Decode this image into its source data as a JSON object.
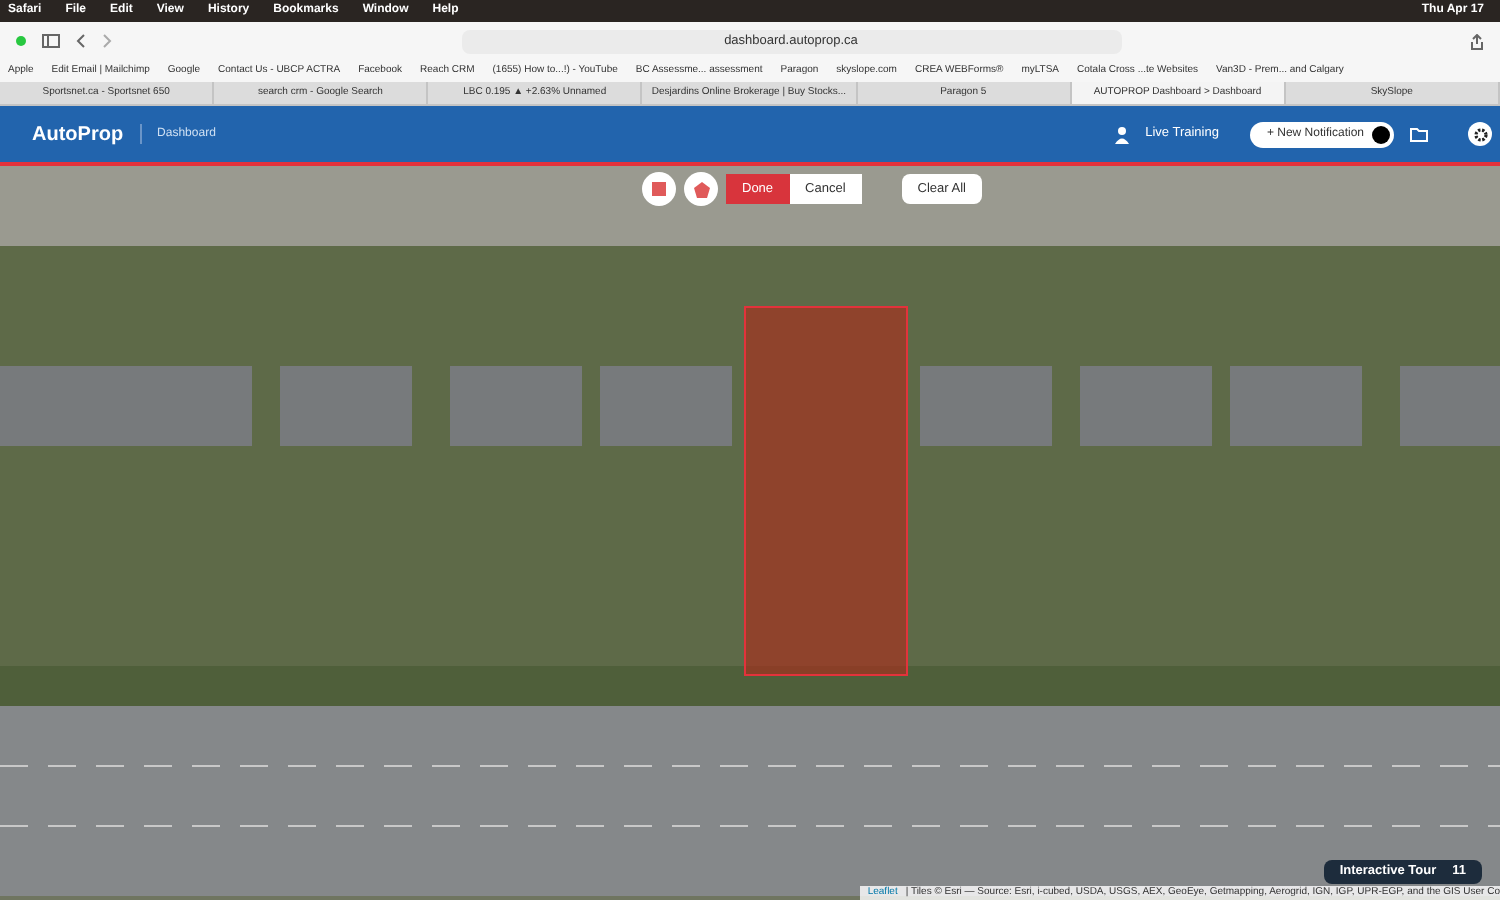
{
  "menu_bar": {
    "items": [
      "Safari",
      "File",
      "Edit",
      "View",
      "History",
      "Bookmarks",
      "Window",
      "Help"
    ],
    "clock": "Thu Apr 17"
  },
  "address_bar": {
    "url": "dashboard.autoprop.ca"
  },
  "bookmarks": [
    "Apple",
    "Edit Email | Mailchimp",
    "Google",
    "Contact Us - UBCP ACTRA",
    "Facebook",
    "Reach CRM",
    "(1655) How to...!) - YouTube",
    "BC Assessme... assessment",
    "Paragon",
    "skyslope.com",
    "CREA WEBForms®",
    "myLTSA",
    "Cotala Cross ...te Websites",
    "Van3D - Prem... and Calgary"
  ],
  "tabs": [
    {
      "label": "Sportsnet.ca - Sportsnet 650",
      "selected": false
    },
    {
      "label": "search crm - Google Search",
      "selected": false
    },
    {
      "label": "LBC 0.195 ▲ +2.63% Unnamed",
      "selected": false
    },
    {
      "label": "Desjardins Online Brokerage | Buy Stocks...",
      "selected": false
    },
    {
      "label": "Paragon 5",
      "selected": false
    },
    {
      "label": "AUTOPROP Dashboard > Dashboard",
      "selected": true
    },
    {
      "label": "SkySlope",
      "selected": false
    }
  ],
  "header": {
    "brand": "AutoProp",
    "section": "Dashboard",
    "live_training": "Live Training",
    "new_notification": "+ New Notification"
  },
  "map": {
    "draw_buttons": [
      "Done",
      "Cancel"
    ],
    "clear_button": "Clear All",
    "tour": {
      "label": "Interactive Tour",
      "count": "11"
    },
    "attribution": {
      "link": "Leaflet",
      "text": "| Tiles © Esri — Source: Esri, i-cubed, USDA, USGS, AEX, GeoEye, Getmapping, Aerogrid, IGN, IGP, UPR-EGP, and the GIS User Co"
    }
  }
}
